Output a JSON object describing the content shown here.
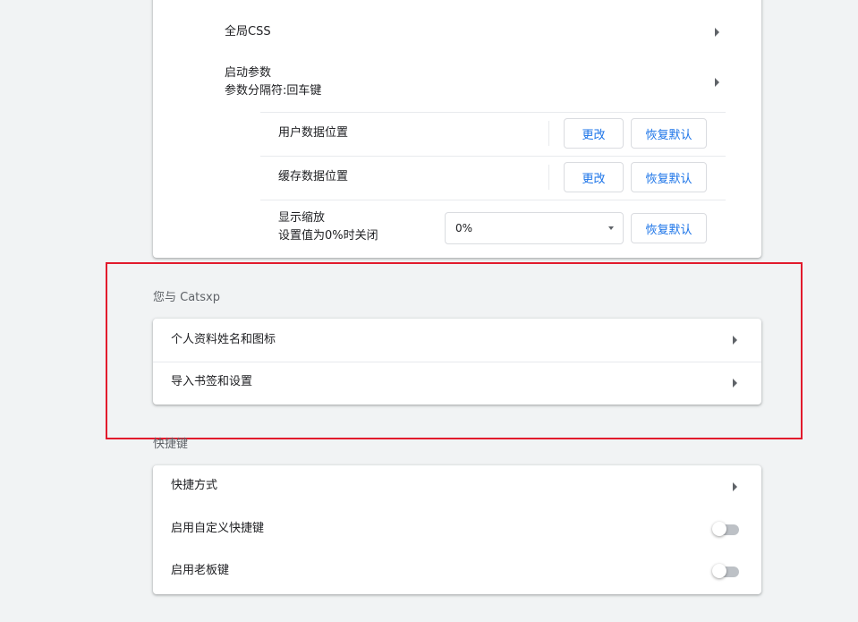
{
  "colors": {
    "page_background": "#f1f3f4",
    "card_background": "#ffffff",
    "link_blue": "#1a73e8",
    "highlight_red": "#e21a2c",
    "toggle_off": "#bdc1c6"
  },
  "advanced": {
    "global_css": {
      "label": "全局CSS",
      "icon": "arrow-right-icon"
    },
    "launch_params": {
      "label": "启动参数",
      "sublabel": "参数分隔符:回车键",
      "icon": "arrow-right-icon"
    },
    "user_data": {
      "label": "用户数据位置",
      "change_label": "更改",
      "reset_label": "恢复默认"
    },
    "cache_data": {
      "label": "缓存数据位置",
      "change_label": "更改",
      "reset_label": "恢复默认"
    },
    "display_zoom": {
      "label": "显示缩放",
      "sublabel": "设置值为0%时关闭",
      "selected_value": "0%",
      "reset_label": "恢复默认"
    }
  },
  "you_section": {
    "title": "您与 Catsxp",
    "items": [
      {
        "label": "个人资料姓名和图标",
        "icon": "arrow-right-icon"
      },
      {
        "label": "导入书签和设置",
        "icon": "arrow-right-icon"
      }
    ]
  },
  "shortcuts_section": {
    "title": "快捷键",
    "shortcut_methods": {
      "label": "快捷方式",
      "icon": "arrow-right-icon"
    },
    "custom_shortcuts": {
      "label": "启用自定义快捷键",
      "enabled": false
    },
    "boss_key": {
      "label": "启用老板键",
      "enabled": false
    }
  }
}
